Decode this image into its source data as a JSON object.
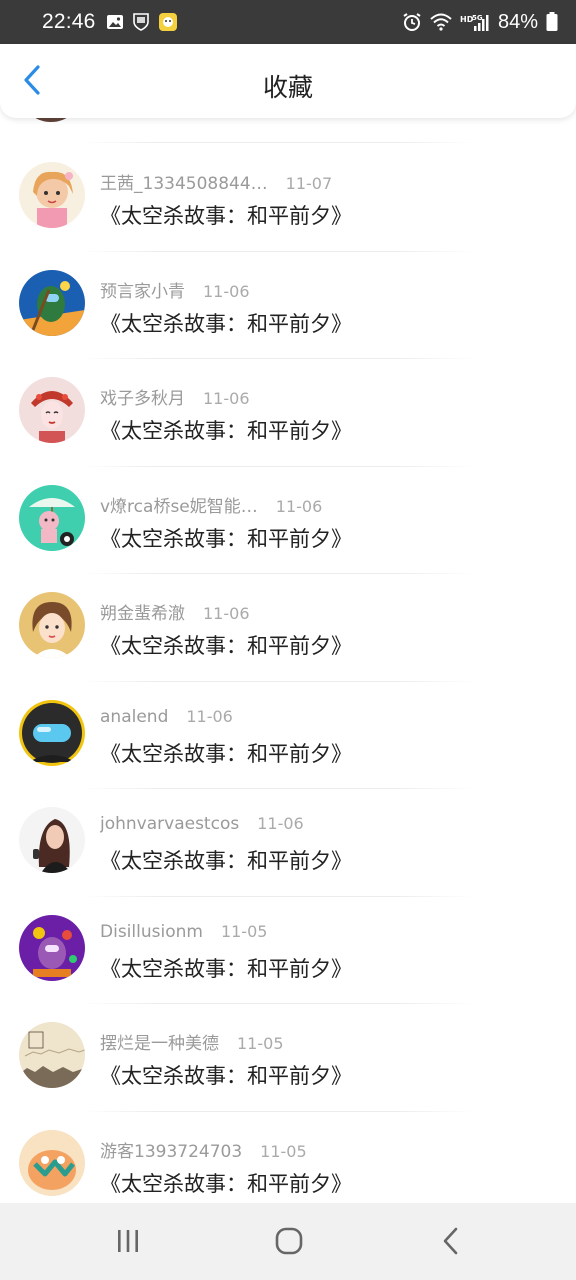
{
  "status_bar": {
    "time": "22:46",
    "battery": "84%",
    "network": "5G",
    "hd_label": "HD"
  },
  "header": {
    "title": "收藏",
    "back_icon": "chevron-left-icon"
  },
  "colors": {
    "accent": "#2a8ce6",
    "status_bar_bg": "#3a3a3a",
    "title_text": "#222222",
    "meta_text": "#9a9a9a"
  },
  "list": {
    "items": [
      {
        "name": "王茜_1334508844…",
        "date": "11-07",
        "title": "《太空杀故事：和平前夕》"
      },
      {
        "name": "预言家小青",
        "date": "11-06",
        "title": "《太空杀故事：和平前夕》"
      },
      {
        "name": "戏子多秋月",
        "date": "11-06",
        "title": "《太空杀故事：和平前夕》"
      },
      {
        "name": "v燎rca桥se妮智能…",
        "date": "11-06",
        "title": "《太空杀故事：和平前夕》"
      },
      {
        "name": "朔金蜚希澈",
        "date": "11-06",
        "title": "《太空杀故事：和平前夕》"
      },
      {
        "name": "analend",
        "date": "11-06",
        "title": "《太空杀故事：和平前夕》"
      },
      {
        "name": "johnvarvaestcos",
        "date": "11-06",
        "title": "《太空杀故事：和平前夕》"
      },
      {
        "name": "Disillusionm",
        "date": "11-05",
        "title": "《太空杀故事：和平前夕》"
      },
      {
        "name": "摆烂是一种美德",
        "date": "11-05",
        "title": "《太空杀故事：和平前夕》"
      },
      {
        "name": "游客1393724703",
        "date": "11-05",
        "title": "《太空杀故事：和平前夕》"
      }
    ]
  },
  "nav_bar": {
    "recents_icon": "recents-icon",
    "home_icon": "home-icon",
    "back_icon": "back-icon"
  }
}
